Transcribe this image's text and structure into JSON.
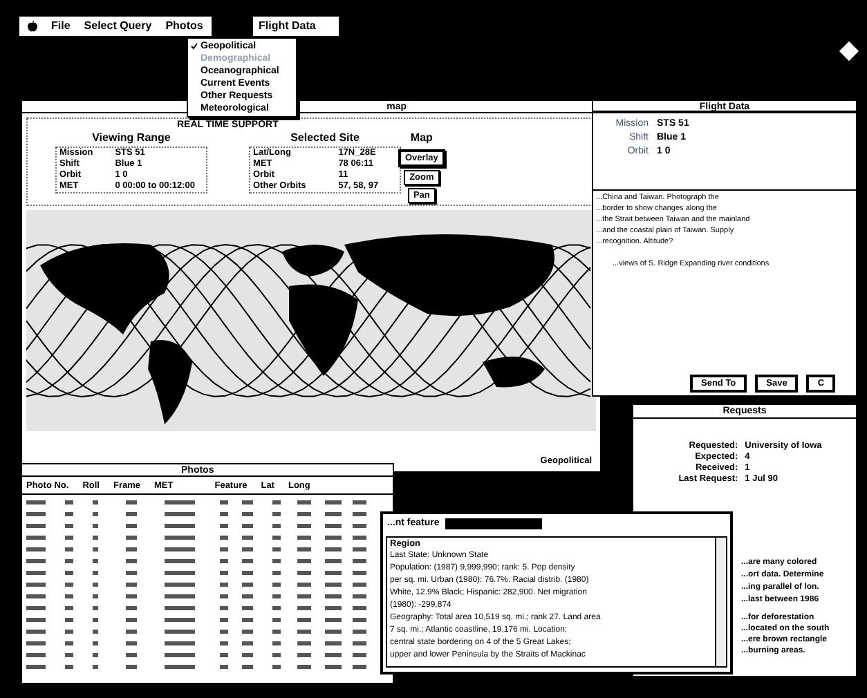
{
  "menu_bar": {
    "items": [
      "File",
      "Select Query",
      "Photos"
    ],
    "window_menu": "Flight Data"
  },
  "dropdown": {
    "items": [
      {
        "label": "Geopolitical",
        "checked": true,
        "disabled": false
      },
      {
        "label": "Demographical",
        "checked": false,
        "disabled": true
      },
      {
        "label": "Oceanographical",
        "checked": false,
        "disabled": false
      },
      {
        "label": "Current Events",
        "checked": false,
        "disabled": false
      },
      {
        "label": "Other Requests",
        "checked": false,
        "disabled": false
      },
      {
        "label": "Meteorological",
        "checked": false,
        "disabled": false
      }
    ]
  },
  "map_window": {
    "title": "map",
    "panel_title": "REAL TIME SUPPORT",
    "viewing_range": {
      "title": "Viewing Range",
      "fields": [
        {
          "label": "Mission",
          "value": "STS 51"
        },
        {
          "label": "Shift",
          "value": "Blue 1"
        },
        {
          "label": "Orbit",
          "value": "1 0"
        },
        {
          "label": "MET",
          "value": "0 00:00 to 00:12:00"
        }
      ]
    },
    "selected_site": {
      "title": "Selected Site",
      "fields": [
        {
          "label": "Lat/Long",
          "value": "17N_28E"
        },
        {
          "label": "MET",
          "value": "78 06:11"
        },
        {
          "label": "Orbit",
          "value": "11"
        },
        {
          "label": "Other Orbits",
          "value": "57, 58, 97"
        }
      ]
    },
    "map_controls": {
      "title": "Map",
      "buttons": [
        {
          "label": "Overlay",
          "selected": true
        },
        {
          "label": "Zoom",
          "selected": false
        },
        {
          "label": "Pan",
          "selected": false
        }
      ]
    },
    "map_caption": "Geopolitical"
  },
  "flight_data": {
    "title": "Flight Data",
    "fields": [
      {
        "label": "Mission",
        "value": "STS 51"
      },
      {
        "label": "Shift",
        "value": "Blue 1"
      },
      {
        "label": "Orbit",
        "value": "1 0"
      }
    ],
    "notes": [
      "...China and Taiwan. Photograph the",
      "...border to show changes along the",
      "...the Strait between Taiwan and the mainland",
      "...and the coastal plain of Taiwan. Supply",
      "...recognition. Altitude?"
    ],
    "note_2": "...views of S. Ridge Expanding river conditions",
    "buttons": [
      "Send To",
      "Save",
      "C"
    ]
  },
  "requests": {
    "title": "Requests",
    "fields": [
      {
        "label": "Requested:",
        "value": "University of Iowa"
      },
      {
        "label": "Expected:",
        "value": "4"
      },
      {
        "label": "Received:",
        "value": "1"
      },
      {
        "label": "Last Request:",
        "value": "1 Jul 90"
      }
    ],
    "notes": [
      "...are many colored",
      "...ort data. Determine",
      "...ing parallel of lon.",
      "...last between 1986"
    ],
    "notes_2": [
      "...for deforestation",
      "...located on the south",
      "...ere brown rectangle",
      "...burning areas."
    ]
  },
  "photos": {
    "title": "Photos",
    "columns": [
      "Photo No.",
      "Roll",
      "Frame",
      "MET",
      "Feature",
      "Lat",
      "Long"
    ]
  },
  "geo_text": {
    "label": "...nt feature",
    "heading": "Region",
    "lines": [
      "Last State: Unknown State",
      "Population: (1987) 9,999,990; rank: 5. Pop density",
      "per sq. mi. Urban (1980): 76.7%. Racial distrib. (1980)",
      "White, 12.9% Black; Hispanic: 282,900. Net migration",
      "(1980): -299,874",
      "Geography: Total area 10,519 sq. mi.; rank 27. Land area",
      "7 sq. mi.; Atlantic coastline, 19,176 mi. Location:",
      "central state bordering on 4 of the 5 Great Lakes;",
      "upper and lower Peninsula by the Straits of Mackinac"
    ]
  }
}
